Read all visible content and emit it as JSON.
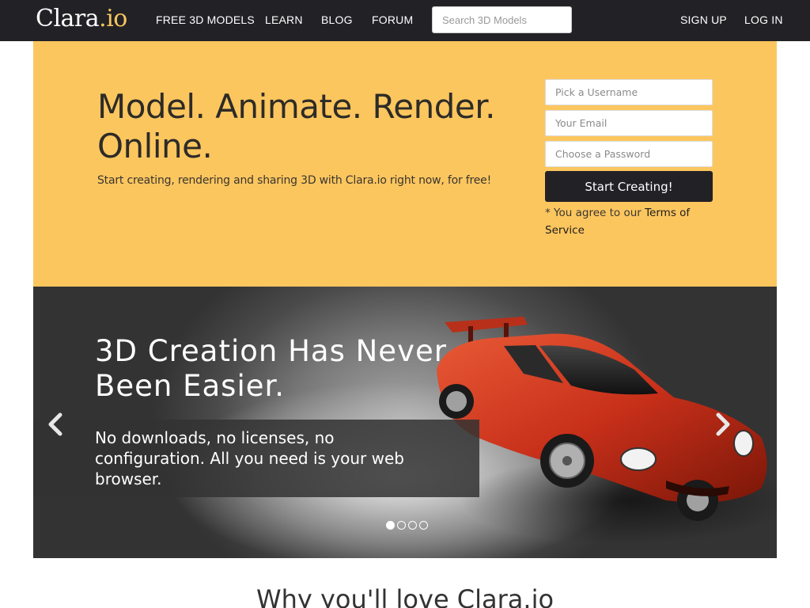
{
  "nav": {
    "brand_main": "Clara",
    "brand_suffix": ".io",
    "links": [
      "FREE 3D MODELS",
      "LEARN",
      "BLOG",
      "FORUM"
    ],
    "search_placeholder": "Search 3D Models",
    "signup": "SIGN UP",
    "login": "LOG IN"
  },
  "hero": {
    "title": "Model. Animate. Render. Online.",
    "tagline": "Start creating, rendering and sharing 3D with Clara.io right now, for free!",
    "username_placeholder": "Pick a Username",
    "email_placeholder": "Your Email",
    "password_placeholder": "Choose a Password",
    "cta": "Start Creating!",
    "tos_prefix": "* You agree to our ",
    "tos_link": "Terms of Service"
  },
  "carousel": {
    "title": "3D Creation Has Never Been Easier.",
    "caption": "No downloads, no licenses, no configuration. All you need is your web browser.",
    "slide_count": 4,
    "active_slide": 1
  },
  "section": {
    "heading": "Why you'll love Clara.io"
  },
  "colors": {
    "navbar": "#222226",
    "hero": "#fcc65f",
    "accent_dot": "#f9c55e",
    "car": "#d23a1c"
  }
}
